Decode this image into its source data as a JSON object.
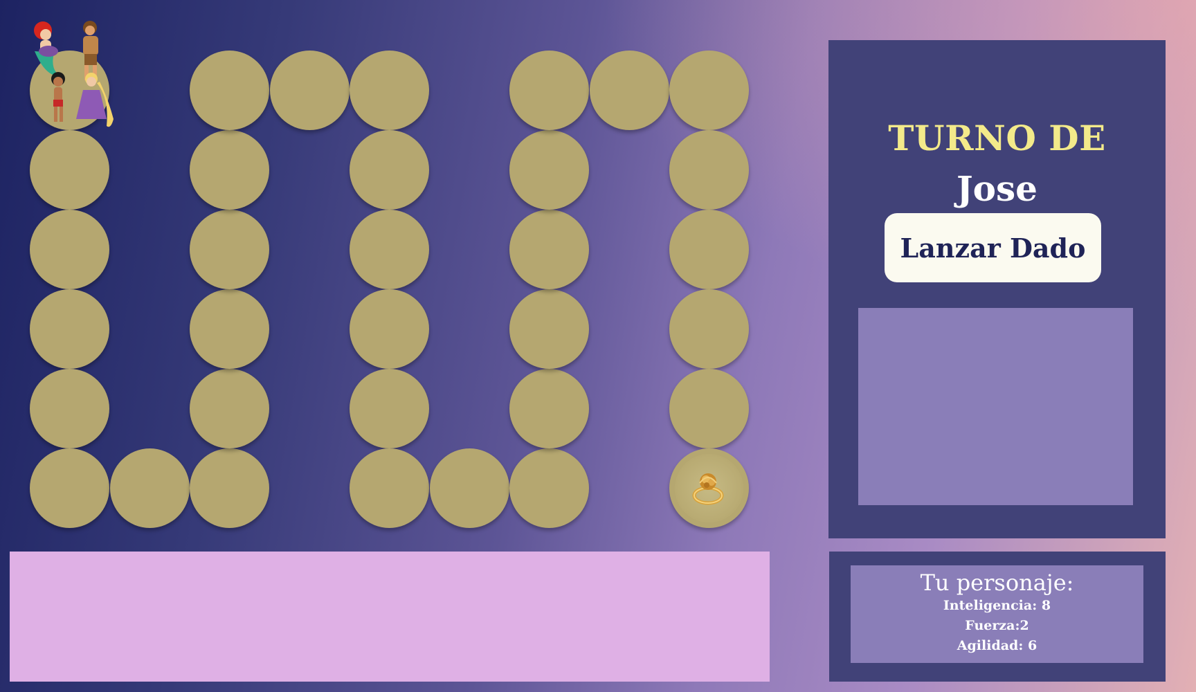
{
  "board": {
    "start_icon": "characters-group-icon",
    "goal_icon": "golden-ring-icon"
  },
  "turn": {
    "label": "TURNO DE",
    "player": "Jose"
  },
  "actions": {
    "roll_label": "Lanzar Dado"
  },
  "character": {
    "title": "Tu personaje:",
    "stats": [
      "Inteligencia: 8",
      "Fuerza:2",
      "Agilidad: 6"
    ]
  },
  "colors": {
    "cell": "#b5a770",
    "panel": "#414278",
    "panel_inner": "#8a7eb8",
    "message_bar": "#dfb0e5",
    "turn_label": "#f3ea8a"
  }
}
